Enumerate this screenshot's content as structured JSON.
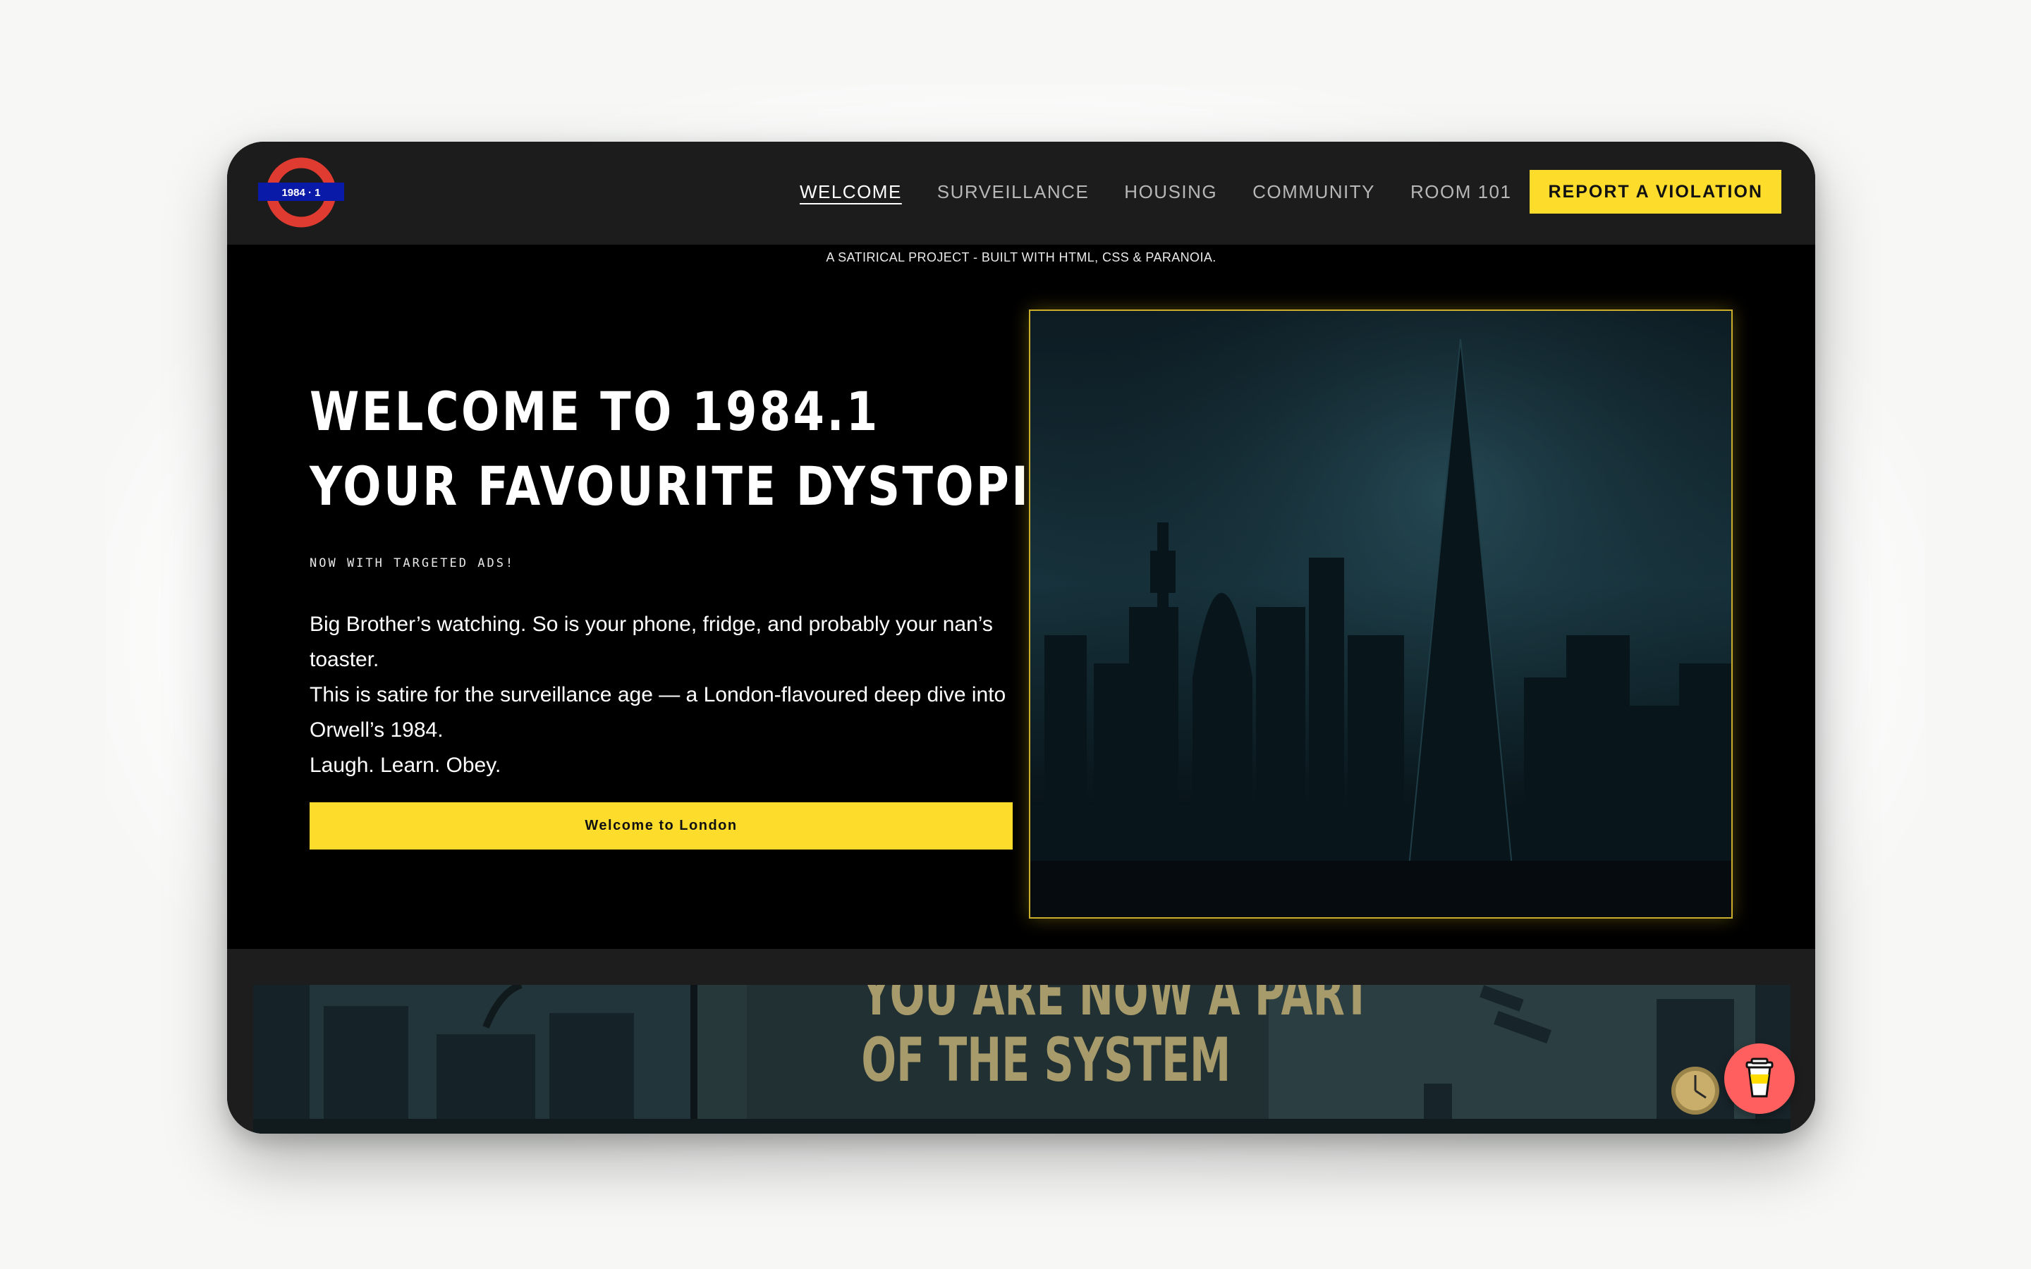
{
  "logo": {
    "text": "1984 · 1"
  },
  "nav": {
    "links": [
      {
        "label": "WELCOME",
        "active": true
      },
      {
        "label": "SURVEILLANCE",
        "active": false
      },
      {
        "label": "HOUSING",
        "active": false
      },
      {
        "label": "COMMUNITY",
        "active": false
      },
      {
        "label": "ROOM 101",
        "active": false
      }
    ],
    "cta_label": "REPORT A VIOLATION"
  },
  "tagline": "A SATIRICAL PROJECT - BUILT WITH HTML, CSS & PARANOIA.",
  "hero": {
    "title_line1": "WELCOME TO 1984.1",
    "title_line2": "YOUR FAVOURITE DYSTOPIA —",
    "kicker": "NOW WITH TARGETED ADS!",
    "desc_line1": "Big Brother’s watching. So is your phone, fridge, and probably your nan’s toaster.",
    "desc_line2": "This is satire for the surveillance age — a London-flavoured deep dive into Orwell’s 1984.",
    "desc_line3": "Laugh. Learn. Obey.",
    "button_label": "Welcome to London"
  },
  "poster": {
    "line1": "YOU ARE NOW A PART",
    "line2": "OF THE SYSTEM"
  },
  "colors": {
    "accent": "#fddc2b",
    "nav_bg": "#1c1c1c",
    "hero_bg": "#000000",
    "roundel_red": "#e03b31",
    "roundel_blue": "#0a1aa8",
    "fab": "#ff5f5f"
  },
  "icons": {
    "logo": "tube-roundel-icon",
    "fab": "coffee-cup-icon"
  }
}
